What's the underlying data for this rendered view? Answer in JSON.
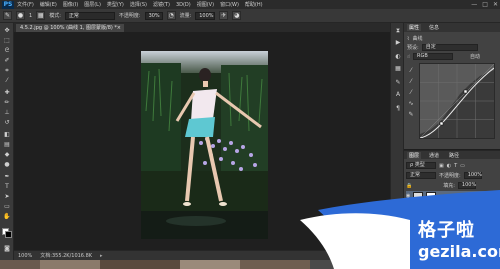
{
  "menubar": {
    "logo": "PS",
    "items": [
      "文件(F)",
      "编辑(E)",
      "图像(I)",
      "图层(L)",
      "类型(Y)",
      "选择(S)",
      "滤镜(T)",
      "3D(D)",
      "视图(V)",
      "窗口(W)",
      "帮助(H)"
    ],
    "window_controls": [
      "—",
      "□",
      "✕"
    ]
  },
  "options": {
    "brush_size": "1",
    "mode_label": "模式:",
    "mode_value": "正常",
    "opacity_label": "不透明度:",
    "opacity_value": "30%",
    "flow_label": "流量:",
    "flow_value": "100%"
  },
  "document": {
    "tab_title": "4.5.2.jpg @ 100% (曲线 1, 图层蒙版/8) *",
    "close": "×"
  },
  "status": {
    "zoom": "100%",
    "doc_info": "文档:355.2K/1016.8K",
    "arrow": "▸"
  },
  "panel": {
    "tabs": [
      "属性",
      "信息"
    ],
    "adjustment_title": "曲线",
    "preset_label": "预设:",
    "preset_value": "自定",
    "channel_value": "RGB",
    "auto_label": "自动"
  },
  "layers": {
    "tabs": [
      "图层",
      "通道",
      "路径"
    ],
    "filter_value": "ρ 类型",
    "blend_value": "正常",
    "opacity_label": "不透明度:",
    "opacity_value": "100%",
    "fill_label": "填充:",
    "fill_value": "100%"
  },
  "watermark": {
    "title": "格子啦",
    "site": "gezila.com"
  },
  "colors": {
    "accent": "#2d6ad6",
    "foreground": "#ffffff",
    "background": "#000000"
  },
  "icons": {
    "tools": [
      "move-icon",
      "marquee-icon",
      "lasso-icon",
      "quick-select-icon",
      "crop-icon",
      "eyedropper-icon",
      "healing-icon",
      "brush-icon",
      "clone-stamp-icon",
      "history-brush-icon",
      "eraser-icon",
      "gradient-icon",
      "blur-icon",
      "dodge-icon",
      "pen-icon",
      "type-icon",
      "path-select-icon",
      "shape-icon",
      "hand-icon",
      "zoom-icon"
    ]
  }
}
